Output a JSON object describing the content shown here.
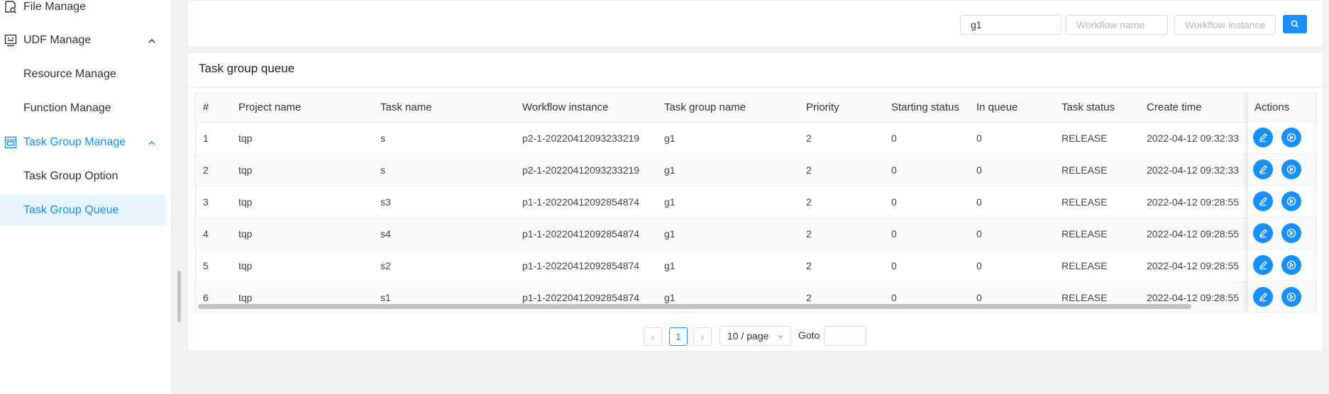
{
  "sidebar": {
    "items": [
      {
        "label": "File Manage",
        "icon": "file-search-icon"
      },
      {
        "label": "UDF Manage",
        "icon": "udf-icon"
      },
      {
        "label": "Resource Manage"
      },
      {
        "label": "Function Manage"
      },
      {
        "label": "Task Group Manage",
        "icon": "task-group-icon"
      },
      {
        "label": "Task Group Option"
      },
      {
        "label": "Task Group Queue"
      }
    ]
  },
  "search": {
    "group_value": "g1",
    "workflow_name_placeholder": "Workflow name",
    "workflow_instance_placeholder": "Workflow instance"
  },
  "table": {
    "title": "Task group queue",
    "columns": [
      "#",
      "Project name",
      "Task name",
      "Workflow instance",
      "Task group name",
      "Priority",
      "Starting status",
      "In queue",
      "Task status",
      "Create time",
      "Actions"
    ],
    "rows": [
      {
        "index": "1",
        "project": "tqp",
        "task": "s",
        "instance": "p2-1-20220412093233219",
        "group": "g1",
        "priority": "2",
        "starting": "0",
        "in_queue": "0",
        "status": "RELEASE",
        "create_time": "2022-04-12 09:32:33"
      },
      {
        "index": "2",
        "project": "tqp",
        "task": "s",
        "instance": "p2-1-20220412093233219",
        "group": "g1",
        "priority": "2",
        "starting": "0",
        "in_queue": "0",
        "status": "RELEASE",
        "create_time": "2022-04-12 09:32:33"
      },
      {
        "index": "3",
        "project": "tqp",
        "task": "s3",
        "instance": "p1-1-20220412092854874",
        "group": "g1",
        "priority": "2",
        "starting": "0",
        "in_queue": "0",
        "status": "RELEASE",
        "create_time": "2022-04-12 09:28:55"
      },
      {
        "index": "4",
        "project": "tqp",
        "task": "s4",
        "instance": "p1-1-20220412092854874",
        "group": "g1",
        "priority": "2",
        "starting": "0",
        "in_queue": "0",
        "status": "RELEASE",
        "create_time": "2022-04-12 09:28:55"
      },
      {
        "index": "5",
        "project": "tqp",
        "task": "s2",
        "instance": "p1-1-20220412092854874",
        "group": "g1",
        "priority": "2",
        "starting": "0",
        "in_queue": "0",
        "status": "RELEASE",
        "create_time": "2022-04-12 09:28:55"
      },
      {
        "index": "6",
        "project": "tqp",
        "task": "s1",
        "instance": "p1-1-20220412092854874",
        "group": "g1",
        "priority": "2",
        "starting": "0",
        "in_queue": "0",
        "status": "RELEASE",
        "create_time": "2022-04-12 09:28:55"
      }
    ]
  },
  "pagination": {
    "current_page": "1",
    "page_size": "10 / page",
    "goto_label": "Goto"
  },
  "colors": {
    "accent": "#1890ff",
    "active_bg": "#e8f4ff"
  }
}
